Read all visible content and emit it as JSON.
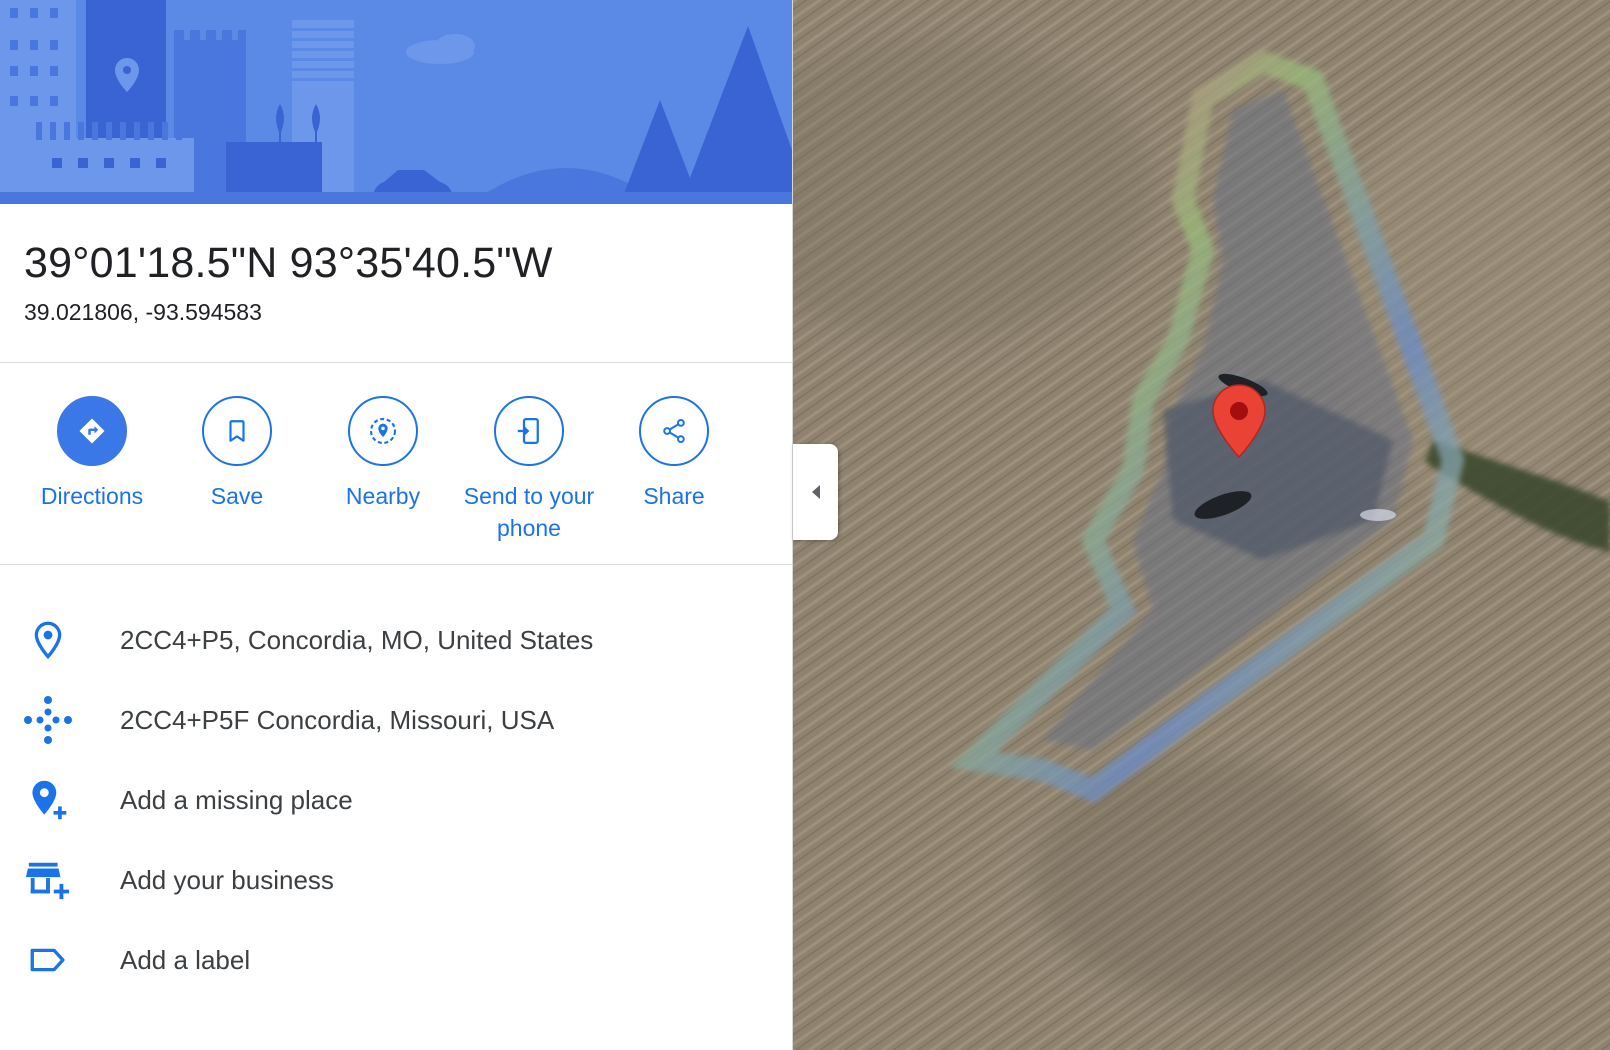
{
  "place": {
    "dms": "39°01'18.5\"N 93°35'40.5\"W",
    "decimal": "39.021806, -93.594583"
  },
  "actions": [
    {
      "label": "Directions",
      "icon": "directions-icon"
    },
    {
      "label": "Save",
      "icon": "bookmark-icon"
    },
    {
      "label": "Nearby",
      "icon": "nearby-icon"
    },
    {
      "label": "Send to your phone",
      "icon": "send-to-phone-icon"
    },
    {
      "label": "Share",
      "icon": "share-icon"
    }
  ],
  "info": [
    {
      "text": "2CC4+P5, Concordia, MO, United States",
      "icon": "location-pin-icon"
    },
    {
      "text": "2CC4+P5F Concordia, Missouri, USA",
      "icon": "plus-code-icon"
    },
    {
      "text": "Add a missing place",
      "icon": "add-place-icon"
    },
    {
      "text": "Add your business",
      "icon": "add-business-icon"
    },
    {
      "text": "Add a label",
      "icon": "label-icon"
    }
  ],
  "colors": {
    "accent": "#1a73e8",
    "hero_background": "#5b8ae6",
    "marker": "#ea4335",
    "field": "#8f8370"
  }
}
